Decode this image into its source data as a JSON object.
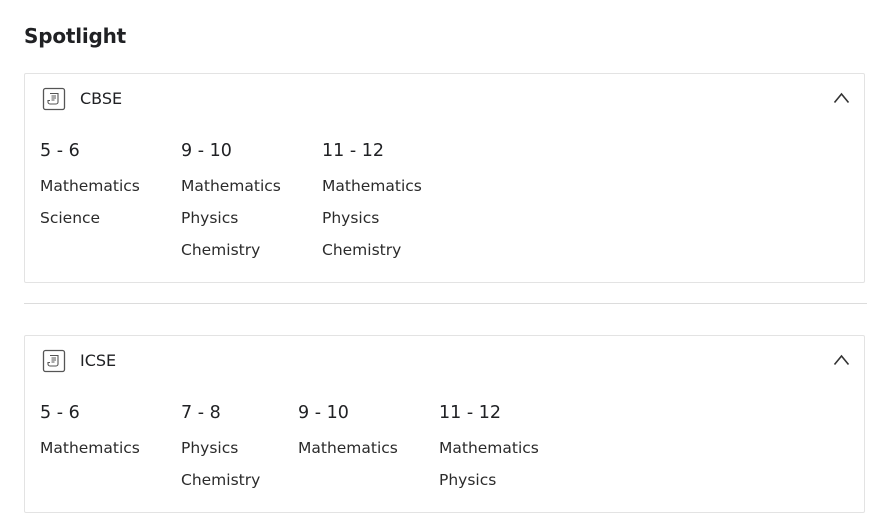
{
  "page": {
    "title": "Spotlight"
  },
  "boards": [
    {
      "name": "CBSE",
      "groups": [
        {
          "grade": "5 - 6",
          "subjects": [
            "Mathematics",
            "Science"
          ]
        },
        {
          "grade": "9 - 10",
          "subjects": [
            "Mathematics",
            "Physics",
            "Chemistry"
          ]
        },
        {
          "grade": "11 - 12",
          "subjects": [
            "Mathematics",
            "Physics",
            "Chemistry"
          ]
        }
      ]
    },
    {
      "name": "ICSE",
      "groups": [
        {
          "grade": "5 - 6",
          "subjects": [
            "Mathematics"
          ]
        },
        {
          "grade": "7 - 8",
          "subjects": [
            "Physics",
            "Chemistry"
          ]
        },
        {
          "grade": "9 - 10",
          "subjects": [
            "Mathematics"
          ]
        },
        {
          "grade": "11 - 12",
          "subjects": [
            "Mathematics",
            "Physics"
          ]
        }
      ]
    }
  ],
  "icons": {
    "board": "document-icon",
    "toggle": "chevron-up-icon"
  }
}
